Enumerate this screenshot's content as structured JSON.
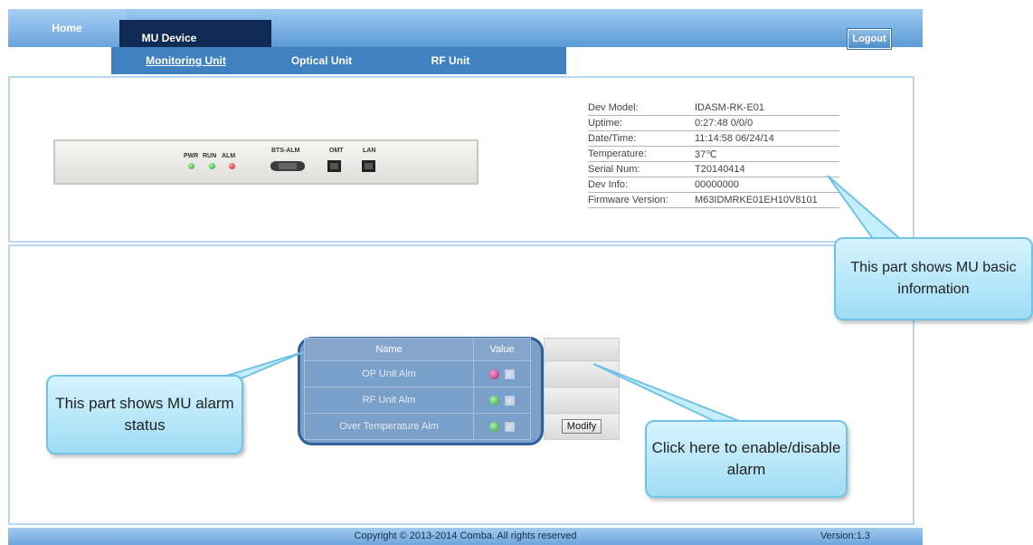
{
  "nav": {
    "home": "Home",
    "mu_device": "MU Device",
    "logout": "Logout",
    "subtabs": [
      "Monitoring Unit",
      "Optical Unit",
      "RF Unit"
    ]
  },
  "device_panel": {
    "labels": {
      "pwr": "PWR",
      "run": "RUN",
      "alm": "ALM",
      "bts_alm": "BTS-ALM",
      "omt": "OMT",
      "lan": "LAN"
    },
    "leds": {
      "pwr": "green",
      "run": "green",
      "alm": "red"
    }
  },
  "info": [
    {
      "key": "Dev Model:",
      "value": "IDASM-RK-E01"
    },
    {
      "key": "Uptime:",
      "value": "0:27:48 0/0/0"
    },
    {
      "key": "Date/Time:",
      "value": "11:14:58 06/24/14"
    },
    {
      "key": "Temperature:",
      "value": "37℃"
    },
    {
      "key": "Serial Num:",
      "value": "T20140414"
    },
    {
      "key": "Dev Info:",
      "value": "00000000"
    },
    {
      "key": "Firmware Version:",
      "value": "M63IDMRKE01EH10V8101"
    }
  ],
  "alarm_table": {
    "headers": {
      "name": "Name",
      "value": "Value"
    },
    "rows": [
      {
        "name": "OP Unit Alm",
        "status": "pink",
        "checked": "✓"
      },
      {
        "name": "RF Unit Alm",
        "status": "green",
        "checked": "✓"
      },
      {
        "name": "Over Temperature Alm",
        "status": "green",
        "checked": "✓"
      }
    ],
    "modify_label": "Modify"
  },
  "callouts": {
    "info": "This part shows MU basic information",
    "alarm": "This part shows MU alarm status",
    "modify": "Click here to enable/disable alarm"
  },
  "footer": {
    "copyright": "Copyright © 2013-2014 Comba. All rights reserved",
    "version": "Version:1.3"
  },
  "colors": {
    "nav_dark": "#0f2a55",
    "subnav": "#3f81c1",
    "callout": "#9fdcf3"
  }
}
